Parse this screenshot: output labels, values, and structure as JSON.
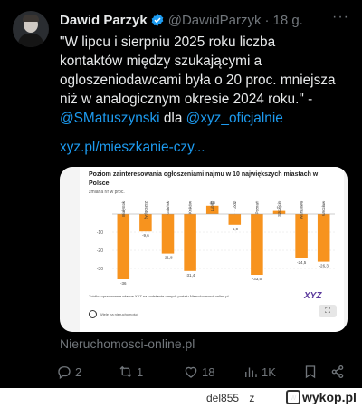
{
  "tweet": {
    "author_name": "Dawid Parzyk",
    "handle": "@DawidParzyk",
    "dot": "·",
    "time": "18 g.",
    "more_glyph": "···",
    "text_lines": [
      "\"W lipcu i sierpniu 2025 roku liczba",
      "kontaktów między szukającymi a",
      "ogloszeniodawcami była o 20 proc. mniejsza",
      "niż w analogicznym okresie 2024 roku.\" -"
    ],
    "mention1": "@SMatuszynski",
    "mention_connector": "dla",
    "mention2": "@xyz_oficjalnie",
    "link": "xyz.pl/mieszkanie-czy...",
    "card_domain": "Nieruchomosci-online.pl"
  },
  "chart_card": {
    "title": "Poziom zainteresowania ogłoszeniami najmu w 10 największych miastach w Polsce",
    "subtitle": "zmiana r/r w proc.",
    "source": "Źródło: opracowanie własne XYZ na podstawie danych portalu Nieruchomosci-online.pl",
    "logo_text": "XYZ",
    "brand_text": "Wiele na nieruchomości",
    "expand_glyph": "⛶",
    "accent_color": "#f7931e"
  },
  "chart_data": {
    "type": "bar",
    "title": "Poziom zainteresowania ogłoszeniami najmu w 10 największych miastach w Polsce",
    "subtitle": "zmiana r/r w proc.",
    "categories": [
      "Białystok",
      "Bydgoszcz",
      "Gdańsk",
      "Kraków",
      "Lublin",
      "Łódź",
      "Poznań",
      "Szczecin",
      "Warszawa",
      "Wrocław"
    ],
    "values": [
      -36,
      -9.6,
      -21.8,
      -31.4,
      4.6,
      -5.9,
      -33.5,
      1.7,
      -24.5,
      -26.3
    ],
    "value_labels": [
      "-36",
      "-9,6",
      "-21,8",
      "-31,4",
      "4,6",
      "-5,9",
      "-33,5",
      "1,7",
      "-24,5",
      "-26,3"
    ],
    "yticks": [
      -10,
      -20,
      -30
    ],
    "ylim": [
      -40,
      8
    ],
    "grid": true,
    "bar_color": "#f7931e"
  },
  "actions": {
    "replies": "2",
    "retweets": "1",
    "likes": "18",
    "views": "1K"
  },
  "wykop": {
    "user": "del855",
    "suffix": "z",
    "brand": "wykop.pl"
  }
}
